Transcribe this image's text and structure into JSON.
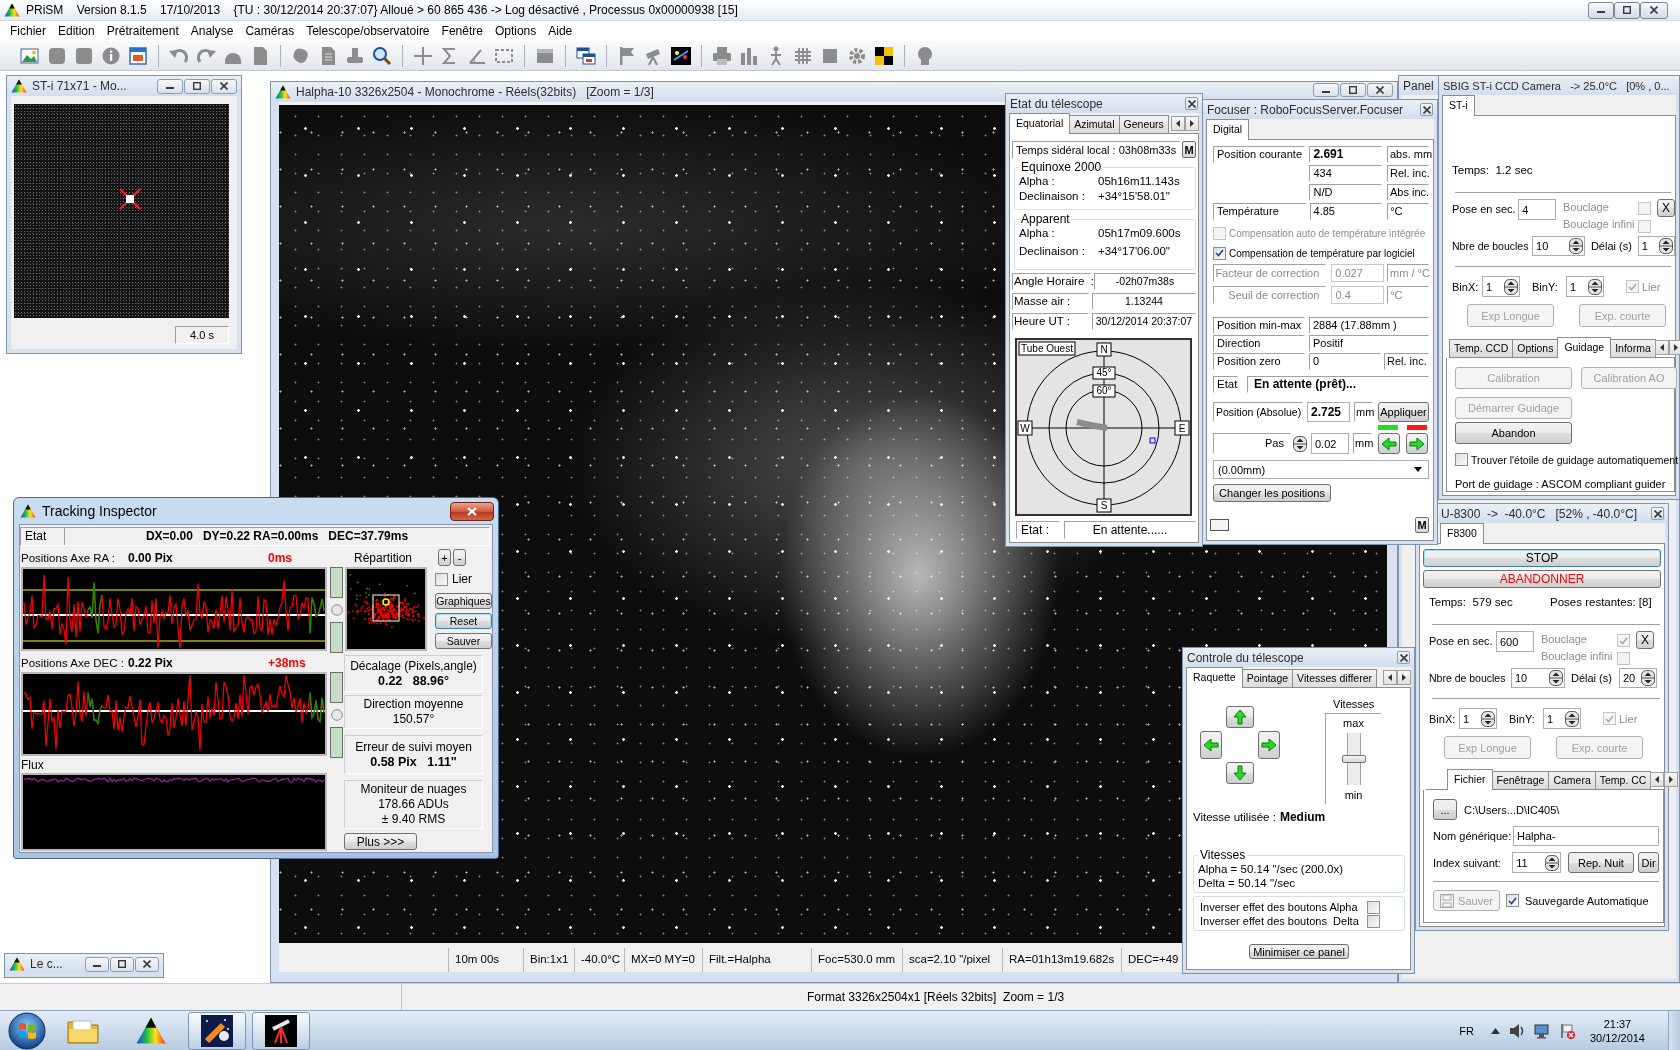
{
  "window": {
    "title": "PRiSM    Version 8.1.5    17/10/2013    {TU : 30/12/2014 20:37:07} Alloué > 60 865 436 -> Log désactivé , Processus 0x00000938 [15]"
  },
  "menu": [
    "Fichier",
    "Edition",
    "Prétraitement",
    "Analyse",
    "Caméras",
    "Telescope/observatoire",
    "Fenêtre",
    "Options",
    "Aide"
  ],
  "panel_window": {
    "title": "Panel"
  },
  "thumbnail_window": {
    "title": "ST-i 71x71 - Mo...",
    "exposure": "4.0 s"
  },
  "image_window": {
    "title": "Halpha-10 3326x2504 - Monochrome - Réels(32bits)   [Zoom = 1/3]",
    "info": [
      "10m 00s",
      "Bin:1x1",
      "-40.0°C",
      "MX=0 MY=0",
      "Filt.=Halpha",
      "Foc=530.0 mm",
      "sca=2.10 \"/pixel",
      "RA=01h13m19.682s",
      "DEC=+49"
    ]
  },
  "telescope_state": {
    "title": "Etat du télescope",
    "tabs": [
      {
        "label": "Equatorial",
        "selected": true
      },
      {
        "label": "Azimutal",
        "selected": false
      },
      {
        "label": "Geneurs",
        "selected": false
      }
    ],
    "sidereal_time": "Temps sidéral local : 03h08m33s",
    "mode_button": "M",
    "groups": [
      {
        "title": "Equinoxe 2000",
        "rows": [
          {
            "label": "Alpha :",
            "value": "05h16m11.143s"
          },
          {
            "label": "Declinaison :",
            "value": "+34°15'58.01\""
          }
        ]
      },
      {
        "title": "Apparent",
        "rows": [
          {
            "label": "Alpha :",
            "value": "05h17m09.600s"
          },
          {
            "label": "Declinaison :",
            "value": "+34°17'06.00\""
          }
        ]
      }
    ],
    "fields": [
      {
        "label": "Angle Horaire  :",
        "value": "-02h07m38s"
      },
      {
        "label": "Masse air :",
        "value": "1.13244"
      },
      {
        "label": "Heure UT :",
        "value": "30/12/2014 20:37:07"
      }
    ],
    "sky_chart": {
      "side": "Tube Ouest",
      "north": "N",
      "south": "S",
      "east": "E",
      "west": "W",
      "rings": [
        "45°",
        "60°"
      ]
    },
    "state_label": "Etat :",
    "state": "En attente......"
  },
  "focuser": {
    "title": "Focuser : RoboFocusServer.Focuser",
    "tabs": [
      {
        "label": "Digital",
        "selected": true
      }
    ],
    "readings": [
      {
        "label": "Position courante",
        "value": "2.691",
        "unit": "abs. mm",
        "bold": true
      },
      {
        "value": "434",
        "unit": "Rel. inc.",
        "bold": false
      },
      {
        "value": "N/D",
        "unit": "Abs inc.",
        "bold": false
      },
      {
        "label": "Température",
        "value": "4.85",
        "unit": "°C",
        "bold": false
      }
    ],
    "compensation": [
      {
        "label": "Compensation auto de température intégrée",
        "checked": false,
        "disabled": true
      },
      {
        "label": "Compensation de température par logiciel",
        "checked": true,
        "disabled": false
      }
    ],
    "corrections": [
      {
        "label": "Facteur de correction",
        "value": "0.027",
        "unit": "mm / °C",
        "disabled": true
      },
      {
        "label": "Seuil de correction",
        "value": "0.4",
        "unit": "°C",
        "disabled": true
      }
    ],
    "info": [
      {
        "label": "Position min-max",
        "value": "2884 (17.88mm )"
      },
      {
        "label": "Direction",
        "value": "Positif"
      },
      {
        "label": "Position zero",
        "value": "0",
        "unit": "Rel. inc."
      }
    ],
    "state_label": "Etat",
    "state": "En attente (prêt)...",
    "absolute": {
      "label": "Position (Absolue)",
      "value": "2.725",
      "unit": "mm",
      "button": "Appliquer"
    },
    "step": {
      "label": "Pas",
      "value": "0.02",
      "unit": "mm"
    },
    "preset": "(0.00mm)",
    "change_button": "Changer les positions",
    "mode_button": "M"
  },
  "guide_camera": {
    "title": "SBIG ST-i CCD Camera   -> 25.0°C   [0% , 0...",
    "tabs": [
      {
        "label": "ST-i",
        "selected": true
      }
    ],
    "time": "Temps:  1.2 sec",
    "exposure": {
      "label": "Pose en sec.",
      "value": "4"
    },
    "loop": {
      "label": "Bouclage",
      "checked": false,
      "disabled": true
    },
    "infinite_loop": {
      "label": "Bouclage infini",
      "checked": false,
      "disabled": true
    },
    "stop_button": "X",
    "count": {
      "label": "Nbre de boucles",
      "value": "10"
    },
    "delay": {
      "label": "Délai (s)",
      "value": "1"
    },
    "binx": {
      "label": "BinX:",
      "value": "1"
    },
    "biny": {
      "label": "BinY:",
      "value": "1"
    },
    "link": {
      "label": "Lier",
      "checked": true,
      "disabled": true
    },
    "buttons": [
      {
        "label": "Exp Longue",
        "disabled": true
      },
      {
        "label": "Exp. courte",
        "disabled": true
      }
    ],
    "subtabs": [
      {
        "label": "Temp. CCD",
        "selected": false
      },
      {
        "label": "Options",
        "selected": false
      },
      {
        "label": "Guidage",
        "selected": true
      },
      {
        "label": "Informa",
        "selected": false
      }
    ],
    "guiding_buttons": [
      {
        "label": "Calibration",
        "disabled": true
      },
      {
        "label": "Calibration AO",
        "disabled": true
      },
      {
        "label": "Démarrer Guidage",
        "disabled": true
      },
      {
        "label": "Abandon",
        "disabled": false
      }
    ],
    "auto_star": {
      "label": "Trouver l'étoile de guidage automatiquement",
      "checked": false
    },
    "port": "Port de guidage : ASCOM compliant guider"
  },
  "main_camera": {
    "title": "U-8300  ->  -40.0°C   [52% , -40.0°C]",
    "tabs": [
      {
        "label": "F8300",
        "selected": true
      }
    ],
    "actions": [
      {
        "label": "STOP",
        "kind": "focused"
      },
      {
        "label": "ABANDONNER",
        "kind": "alert"
      }
    ],
    "time": "Temps:  579 sec",
    "remaining": "Poses restantes: [8]",
    "exposure": {
      "label": "Pose en sec.",
      "value": "600"
    },
    "loop": {
      "label": "Bouclage",
      "checked": true,
      "disabled": true
    },
    "infinite_loop": {
      "label": "Bouclage infini",
      "checked": false,
      "disabled": true
    },
    "stop_button": "X",
    "count": {
      "label": "Nbre de boucles",
      "value": "10"
    },
    "delay": {
      "label": "Délai (s)",
      "value": "20"
    },
    "binx": {
      "label": "BinX:",
      "value": "1"
    },
    "biny": {
      "label": "BinY:",
      "value": "1"
    },
    "link": {
      "label": "Lier",
      "checked": true,
      "disabled": true
    },
    "buttons": [
      {
        "label": "Exp Longue",
        "disabled": true
      },
      {
        "label": "Exp. courte",
        "disabled": true
      }
    ],
    "subtabs": [
      {
        "label": "Fichier",
        "selected": true
      },
      {
        "label": "Fenêtrage",
        "selected": false
      },
      {
        "label": "Camera",
        "selected": false
      },
      {
        "label": "Temp. CC",
        "selected": false
      }
    ],
    "browse_button": "...",
    "path": "C:\\Users...D\\IC405\\",
    "name": {
      "label": "Nom générique:",
      "value": "Halpha-"
    },
    "index": {
      "label": "Index suivant:",
      "value": "11"
    },
    "night_button": "Rep. Nuit",
    "dir_button": "Dir",
    "save_button": {
      "label": "Sauver",
      "disabled": true
    },
    "auto_save": {
      "label": "Sauvegarde Automatique",
      "checked": true
    }
  },
  "telescope_control": {
    "title": "Controle du télescope",
    "tabs": [
      {
        "label": "Raquette",
        "selected": true
      },
      {
        "label": "Pointage",
        "selected": false
      },
      {
        "label": "Vitesses differer",
        "selected": false
      }
    ],
    "speed_label": "Vitesses",
    "speed_max": "max",
    "speed_min": "min",
    "speed": {
      "level": 0.5
    },
    "speed_used_label": "Vitesse utilisée :",
    "speed_used": "Medium",
    "rates_title": "Vitesses",
    "rates": [
      "Alpha = 50.14 \"/sec (200.0x)",
      "Delta = 50.14 \"/sec"
    ],
    "invert": [
      {
        "label": "Inverser effet des boutons Alpha",
        "checked": false
      },
      {
        "label": "Inverser effet des boutons  Delta",
        "checked": false
      }
    ],
    "minimize_button": "Minimiser ce panel"
  },
  "tracking_inspector": {
    "title": "Tracking Inspector",
    "state_label": "Etat",
    "state": "DX=0.00   DY=0.22 RA=0.00ms   DEC=37.79ms",
    "axes": [
      {
        "label": "Positions Axe RA :",
        "value": "0.00 Pix",
        "correction": "0ms"
      },
      {
        "label": "Positions Axe DEC :",
        "value": "0.22 Pix",
        "correction": "+38ms"
      }
    ],
    "flux_label": "Flux",
    "distribution_label": "Répartition",
    "zoom_buttons": [
      "+",
      "-"
    ],
    "link": {
      "label": "Lier",
      "checked": false
    },
    "buttons": [
      {
        "label": "Graphiques",
        "focused": false
      },
      {
        "label": "Reset",
        "focused": true
      },
      {
        "label": "Sauver",
        "focused": false
      }
    ],
    "stats": [
      {
        "title": "Décalage (Pixels,angle)",
        "lines": [
          "0.22   88.96°"
        ],
        "bold": true
      },
      {
        "title": "Direction moyenne",
        "lines": [
          "150.57°"
        ],
        "bold": false
      },
      {
        "title": "Erreur de suivi moyen",
        "lines": [
          "0.58 Pix   1.11\""
        ],
        "bold": true
      },
      {
        "title": "Moniteur de nuages",
        "lines": [
          "178.66 ADUs",
          "± 9.40 RMS"
        ],
        "bold": false
      }
    ],
    "more_button": "Plus >>>"
  },
  "minimized_window": {
    "title": "Le c..."
  },
  "status_bar": {
    "text": "Format 3326x2504x1 [Réels 32bits]  Zoom = 1/3"
  },
  "taskbar": {
    "language": "FR",
    "time": "21:37",
    "date": "30/12/2014"
  }
}
